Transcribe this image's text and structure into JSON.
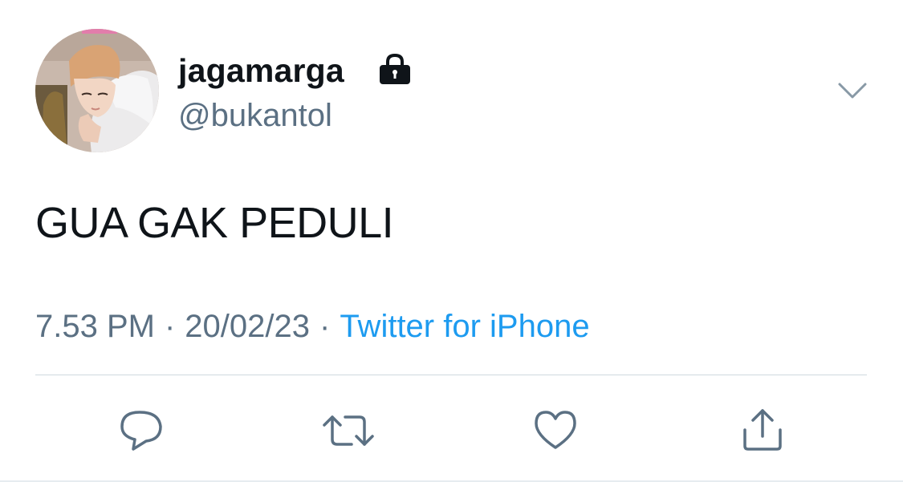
{
  "user": {
    "display_name": "jagamarga",
    "handle": "@bukantol",
    "protected_icon": "lock-icon",
    "avatar": "profile-photo"
  },
  "tweet": {
    "text": "GUA GAK PEDULI",
    "time": "7.53 PM",
    "date": "20/02/23",
    "separator": "·",
    "source": "Twitter for iPhone"
  },
  "actions": [
    {
      "name": "reply",
      "icon": "comment-icon"
    },
    {
      "name": "retweet",
      "icon": "retweet-icon"
    },
    {
      "name": "like",
      "icon": "heart-icon"
    },
    {
      "name": "share",
      "icon": "share-icon"
    }
  ],
  "colors": {
    "text": "#0f1419",
    "secondary": "#5b7083",
    "link": "#1d9bf0",
    "divider": "#cfd9de",
    "icon": "#5b7083"
  }
}
